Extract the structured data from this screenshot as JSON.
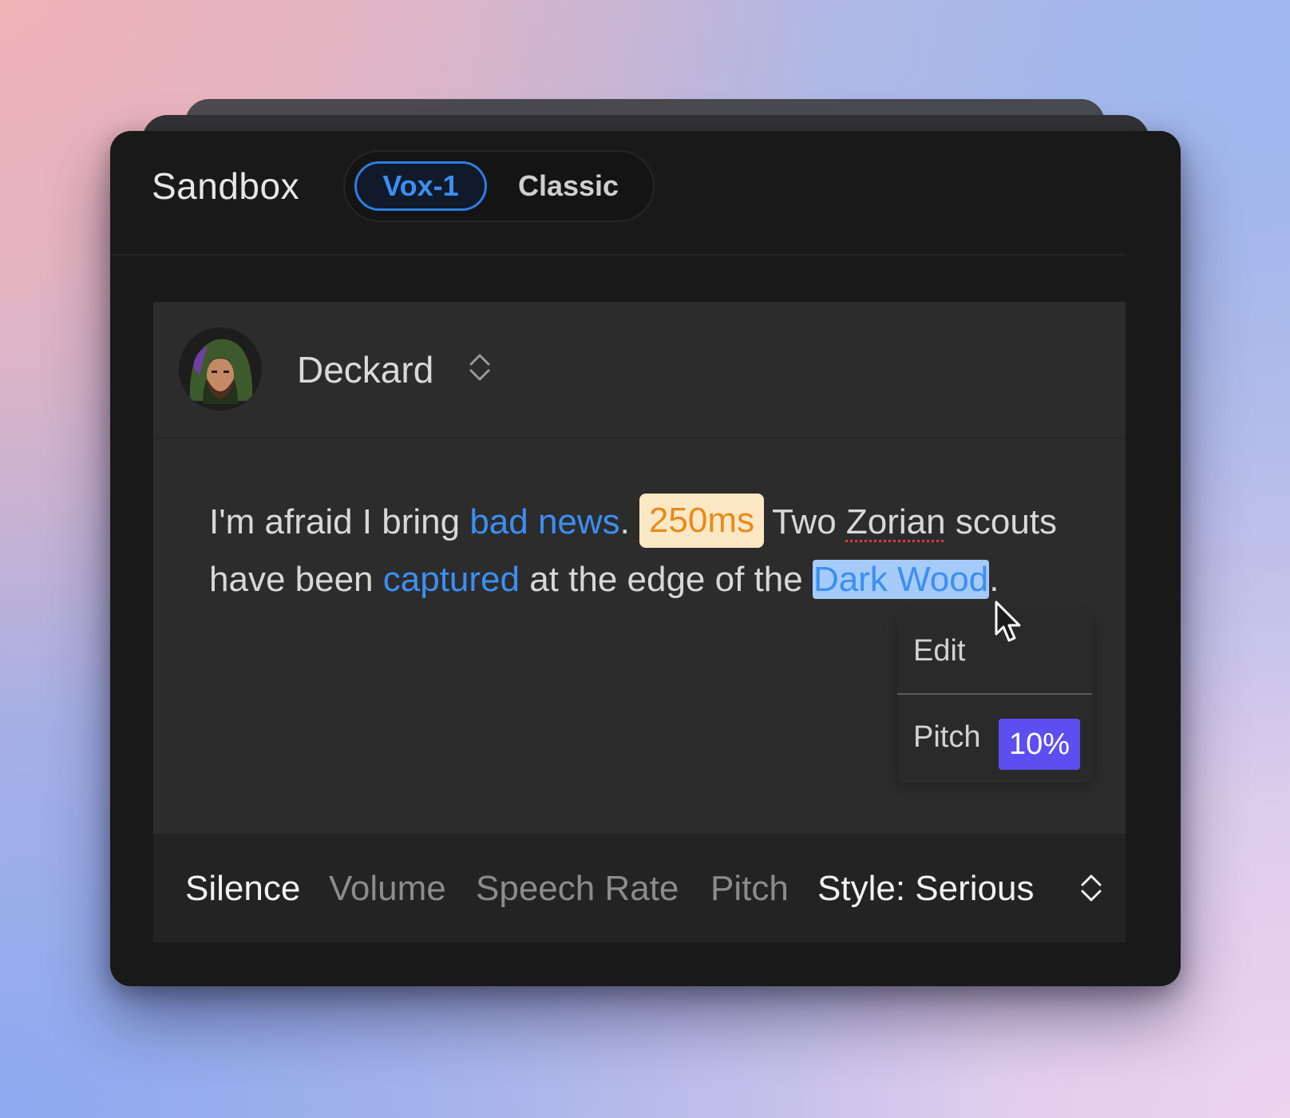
{
  "app": {
    "title": "Sandbox"
  },
  "model_toggle": {
    "options": [
      "Vox-1",
      "Classic"
    ],
    "selected": "Vox-1",
    "accent": "#2f7de0"
  },
  "voice": {
    "name": "Deckard"
  },
  "script_text": {
    "line1": {
      "part1": "I'm afraid I bring ",
      "kw1": "bad news",
      "part2": ".",
      "pause": "250ms",
      "part3": "Two ",
      "misspelled": "Zorian",
      "part4": " scouts"
    },
    "line2": {
      "part1": "have been ",
      "kw1": "captured",
      "part2": " at the edge of the ",
      "selected": "Dark Wood",
      "part3": "."
    }
  },
  "context_menu": {
    "edit_label": "Edit",
    "pitch_label": "Pitch",
    "pitch_value": "10%",
    "pitch_color": "#5d4ef0"
  },
  "toolbar": {
    "silence": "Silence",
    "volume": "Volume",
    "speech_rate": "Speech Rate",
    "pitch": "Pitch",
    "style": "Style: Serious"
  },
  "colors": {
    "keyword": "#3b8ff2",
    "pause_bg": "#fde8c6",
    "pause_text": "#e88a1a",
    "selection_bg": "#a6cbf9"
  }
}
